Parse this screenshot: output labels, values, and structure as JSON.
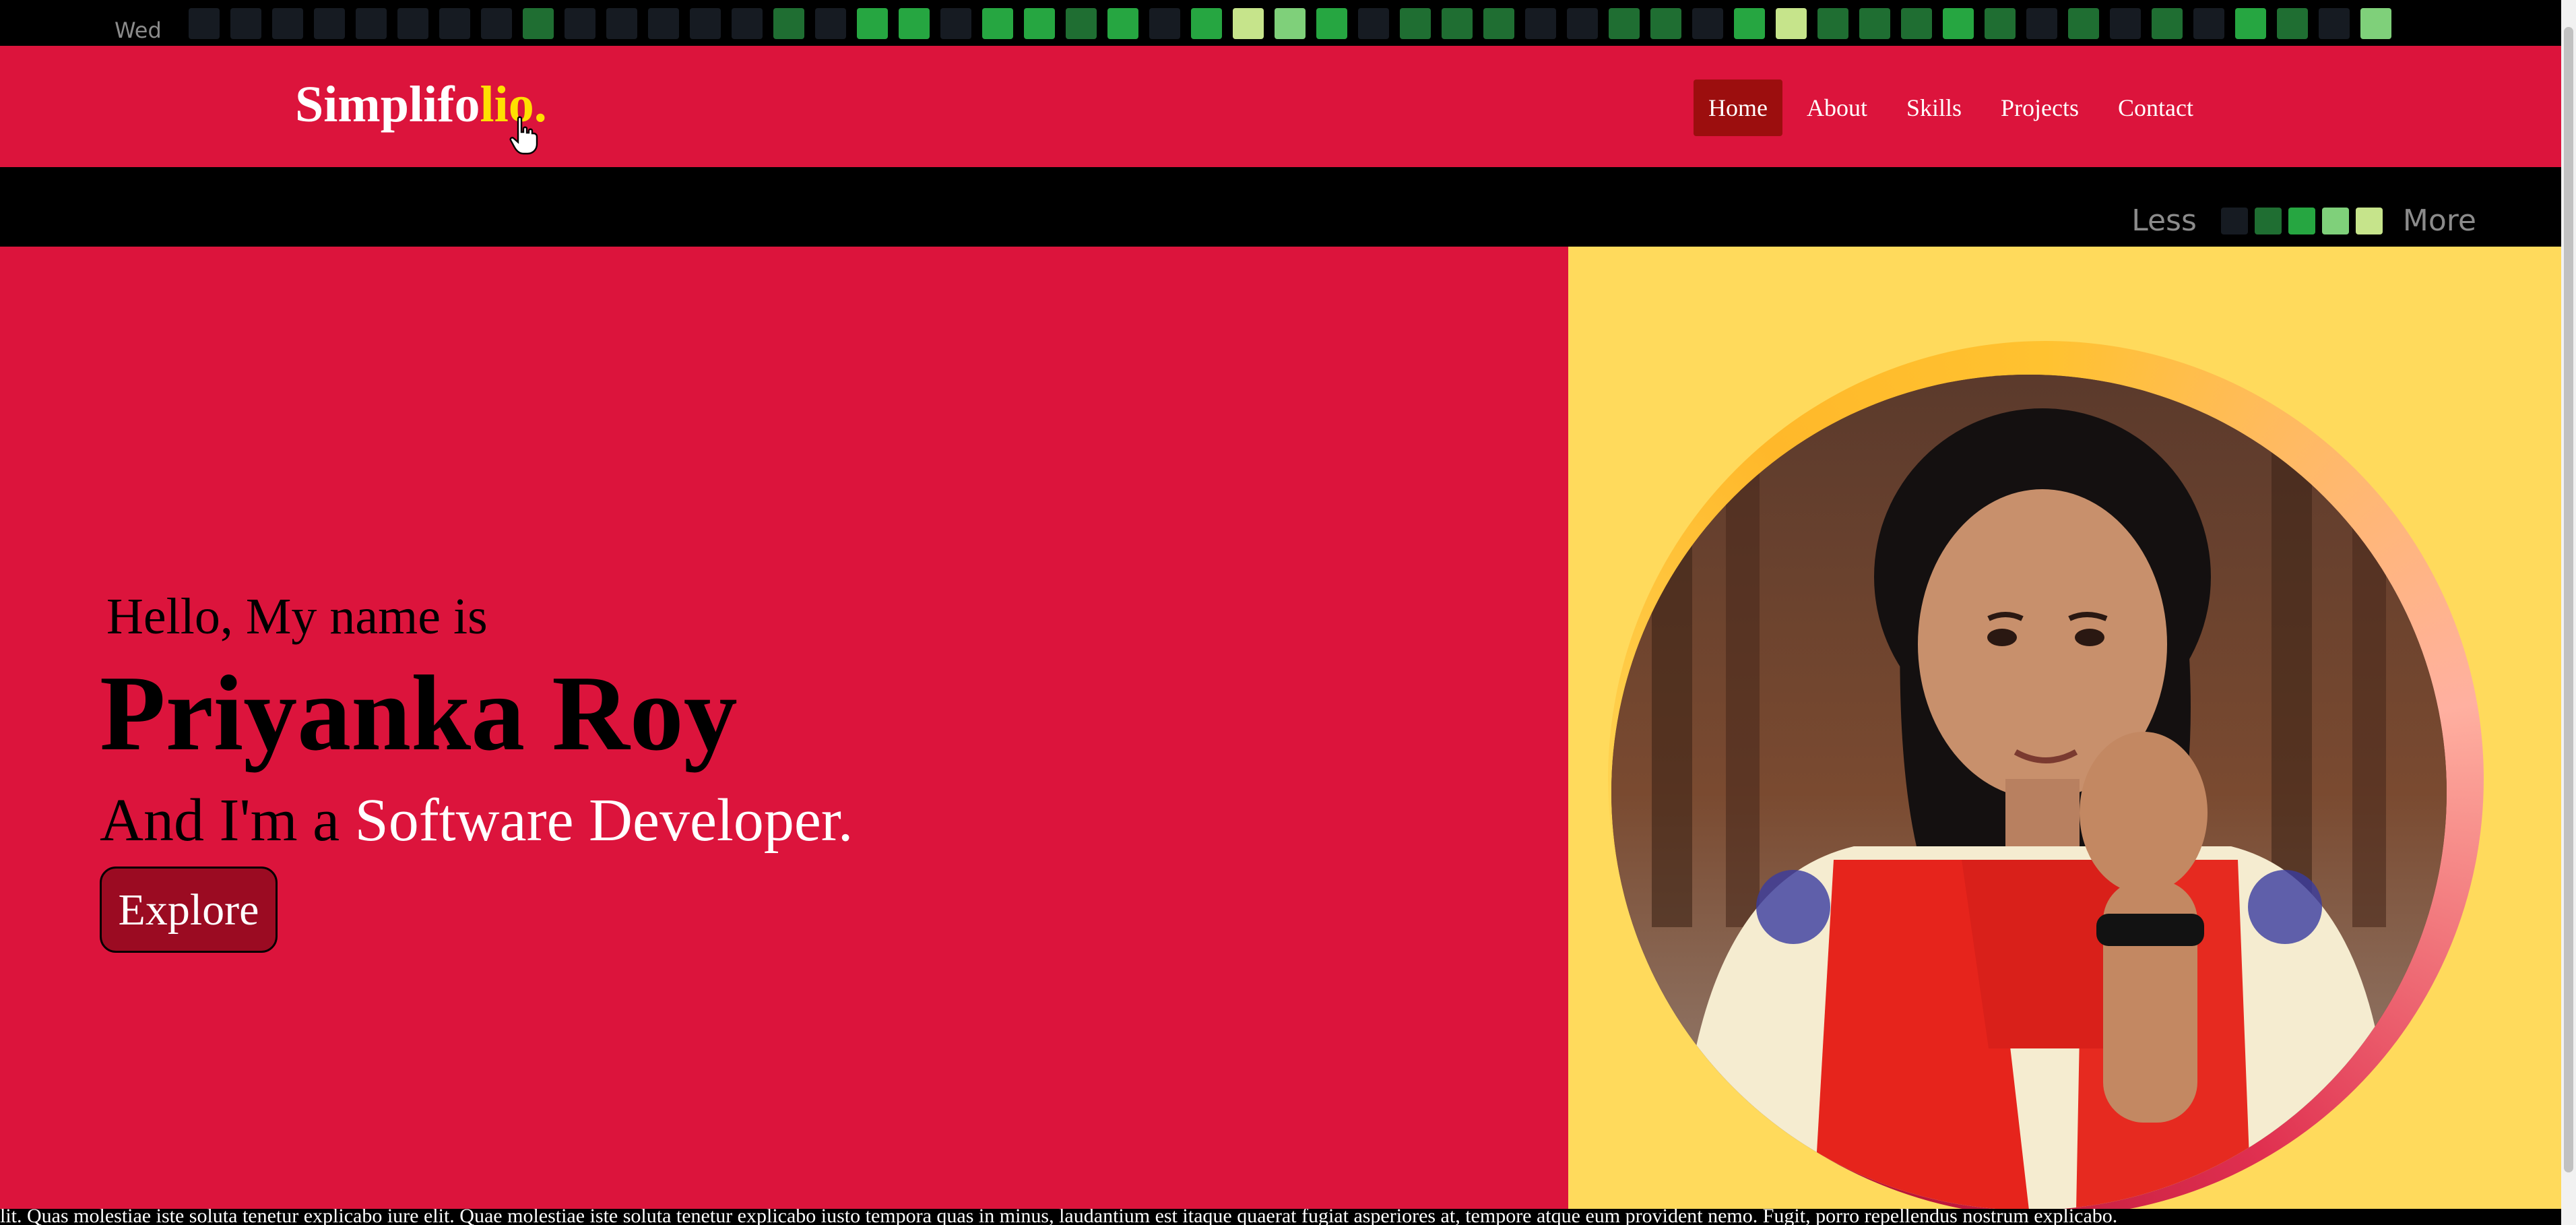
{
  "contribution": {
    "day_label": "Wed",
    "legend_less": "Less",
    "legend_more": "More",
    "legend_colors": [
      "#161b22",
      "#1f6e32",
      "#26a641",
      "#7fd07a",
      "#c6e48b"
    ],
    "row_colors": [
      "#161b22",
      "#161b22",
      "#161b22",
      "#161b22",
      "#161b22",
      "#161b22",
      "#161b22",
      "#161b22",
      "#1f6e32",
      "#161b22",
      "#161b22",
      "#161b22",
      "#161b22",
      "#161b22",
      "#1f6e32",
      "#161b22",
      "#26a641",
      "#26a641",
      "#161b22",
      "#26a641",
      "#26a641",
      "#1f6e32",
      "#26a641",
      "#161b22",
      "#26a641",
      "#c6e48b",
      "#7fd07a",
      "#26a641",
      "#161b22",
      "#1f6e32",
      "#1f6e32",
      "#1f6e32",
      "#161b22",
      "#161b22",
      "#1f6e32",
      "#1f6e32",
      "#161b22",
      "#26a641",
      "#c6e48b",
      "#1f6e32",
      "#1f6e32",
      "#1f6e32",
      "#26a641",
      "#1f6e32",
      "#161b22",
      "#1f6e32",
      "#161b22",
      "#1f6e32",
      "#161b22",
      "#26a641",
      "#1f6e32",
      "#161b22",
      "#7fd07a"
    ]
  },
  "navbar": {
    "brand_main": "Simplifo",
    "brand_accent": "lio.",
    "items": [
      {
        "label": "Home",
        "active": true
      },
      {
        "label": "About",
        "active": false
      },
      {
        "label": "Skills",
        "active": false
      },
      {
        "label": "Projects",
        "active": false
      },
      {
        "label": "Contact",
        "active": false
      }
    ]
  },
  "hero": {
    "greeting": "Hello, My name is",
    "name": "Priyanka Roy",
    "role_prefix": "And I'm a ",
    "role_highlight": "Software Developer.",
    "button_label": "Explore",
    "portrait_icon": "profile-photo"
  },
  "footer": {
    "text": "lit. Quas molestiae iste soluta tenetur explicabo iure elit. Quae molestiae iste soluta tenetur explicabo iusto tempora quas in minus, laudantium est itaque quaerat fugiat asperiores at, tempore atque eum provident nemo. Fugit, porro repellendus nostrum explicabo."
  },
  "colors": {
    "primary": "#dc143c",
    "accent_yellow": "#ffe000",
    "panel_yellow": "#ffda5c",
    "active_nav": "#9c0e0e",
    "button": "#9b0b22"
  }
}
